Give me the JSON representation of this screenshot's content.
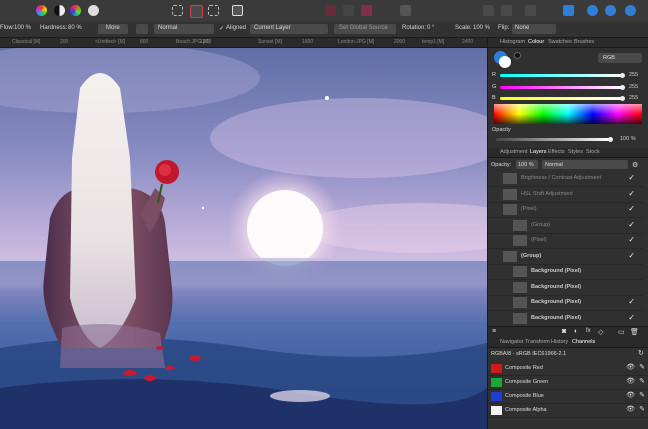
{
  "context_bar": {
    "flow": "Flow:",
    "flow_value": "100 %",
    "hardness": "Hardness:",
    "hardness_value": "80 %",
    "more": "More",
    "blend": "Normal",
    "aligned": "Aligned",
    "source": "Current Layer",
    "set_global_source": "Set Global Source",
    "rotation": "Rotation:",
    "rotation_value": "0 °",
    "scale": "Scale:",
    "scale_value": "100 %",
    "flip": "Flip:",
    "flip_value": "None"
  },
  "ruler_labels": [
    "Classical [M]",
    "<Unttled> [M]",
    "Beach.JPG [M]",
    "Sunset [M]",
    "London.JPG [M]",
    "temp1 [M]"
  ],
  "ruler_numbers": [
    "200",
    "400",
    "600",
    "800",
    "1000",
    "1200",
    "1400",
    "1600",
    "1800",
    "2000",
    "2200",
    "2400"
  ],
  "colour_panel": {
    "tabs": [
      "Histogram",
      "Colour",
      "Swatches",
      "Brushes"
    ],
    "active_tab": "Colour",
    "model": "RGB",
    "r_label": "R",
    "r_value": "255",
    "g_label": "G",
    "g_value": "255",
    "b_label": "B",
    "b_value": "255",
    "r_level": 1.0,
    "g_level": 1.0,
    "b_level": 1.0,
    "opacity_label": "Opacity",
    "opacity_value": "100 %",
    "opacity_level": 1.0
  },
  "layers_panel": {
    "tabs": [
      "Adjustment",
      "Layers",
      "Effects",
      "Styles",
      "Stock"
    ],
    "active_tab": "Layers",
    "opacity_label": "Opacity:",
    "opacity_value": "100 %",
    "blend": "Normal",
    "layers": [
      {
        "name": "Brightness / Contrast Adjustment",
        "dim": true,
        "checked": true,
        "indent": 0
      },
      {
        "name": "HSL Shift Adjustment",
        "dim": true,
        "checked": true,
        "indent": 0
      },
      {
        "name": "(Pixel)",
        "dim": true,
        "checked": true,
        "indent": 0
      },
      {
        "name": "(Group)",
        "dim": true,
        "checked": true,
        "indent": 1
      },
      {
        "name": "(Pixel)",
        "dim": true,
        "checked": true,
        "indent": 1
      },
      {
        "name": "(Group)",
        "dim": false,
        "checked": true,
        "indent": 0
      },
      {
        "name": "Background (Pixel)",
        "dim": false,
        "checked": false,
        "indent": 1
      },
      {
        "name": "Background (Pixel)",
        "dim": false,
        "checked": false,
        "indent": 1
      },
      {
        "name": "Background (Pixel)",
        "dim": false,
        "checked": true,
        "indent": 1
      },
      {
        "name": "Background (Pixel)",
        "dim": false,
        "checked": true,
        "indent": 1
      }
    ]
  },
  "channels_panel": {
    "tabs": [
      "Navigator",
      "Transform",
      "History",
      "Channels"
    ],
    "active_tab": "Channels",
    "profile": "RGBA/8 - sRGB IEC61966-2.1",
    "channels": [
      {
        "name": "Composite Red",
        "color": "#d21a1a"
      },
      {
        "name": "Composite Green",
        "color": "#19a83a"
      },
      {
        "name": "Composite Blue",
        "color": "#1a3fd2"
      },
      {
        "name": "Composite Alpha",
        "color": "#f2f2f2"
      }
    ]
  },
  "colors": {
    "toolbar_bg": "#3a3a3a",
    "panel_bg": "#303030",
    "accent": "#2f7fd8"
  }
}
